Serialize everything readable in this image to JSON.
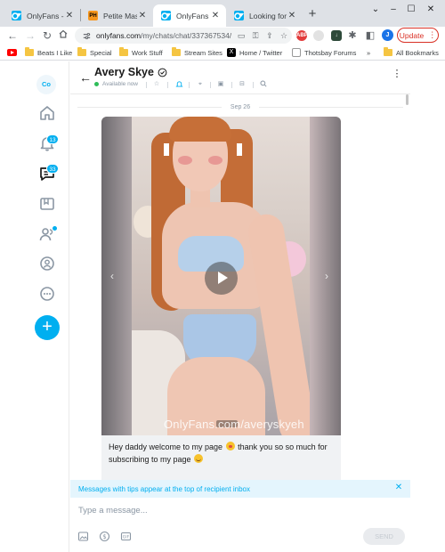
{
  "browser": {
    "tabs": [
      {
        "title": "OnlyFans - Fr",
        "icon": "onlyfans-favicon"
      },
      {
        "title": "Petite Masse",
        "icon": "ph-favicon"
      },
      {
        "title": "OnlyFans",
        "icon": "onlyfans-favicon"
      },
      {
        "title": "Looking for s",
        "icon": "onlyfans-favicon"
      }
    ],
    "active_tab_index": 2,
    "url_host": "onlyfans.com",
    "url_path": "/my/chats/chat/337367534/",
    "profile_initial": "J",
    "update_label": "Update",
    "bookmarks": [
      "Beats I Like",
      "Special",
      "Work Stuff",
      "Stream Sites",
      "Home / Twitter",
      "Thotsbay Forums"
    ],
    "overflow": "»",
    "all_bookmarks": "All Bookmarks"
  },
  "sidebar": {
    "avatar_initials": "Co",
    "notifications_count": "13",
    "messages_count": "33",
    "accent": "#00aff0"
  },
  "chat": {
    "name": "Avery Skye",
    "status": "Available now",
    "date": "Sep 26",
    "media_watermark": "OnlyFans.com/averyskyeh",
    "caption_part1": "Hey daddy welcome to my page ",
    "caption_part2": " thank you so so much for subscribing to my page "
  },
  "banner": {
    "text": "Messages with tips appear at the top of recipient inbox"
  },
  "composer": {
    "placeholder": "Type a message...",
    "send_label": "SEND"
  }
}
